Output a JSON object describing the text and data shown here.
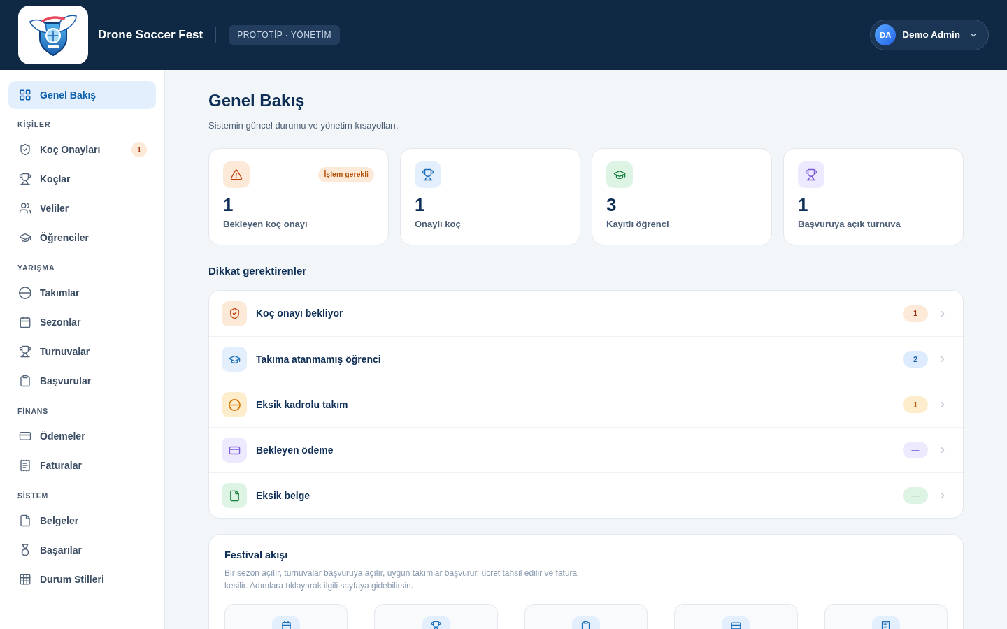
{
  "header": {
    "title": "Drone Soccer Fest",
    "badge": "PROTOTİP · YÖNETİM",
    "user": {
      "initials": "DA",
      "name": "Demo Admin"
    }
  },
  "sidebar": {
    "sections": [
      {
        "items": [
          {
            "label": "Genel Bakış",
            "selected": true
          }
        ]
      },
      {
        "heading": "KİŞİLER",
        "items": [
          {
            "label": "Koç Onayları",
            "selected": false,
            "badge": "1"
          },
          {
            "label": "Koçlar",
            "selected": false
          },
          {
            "label": "Veliler",
            "selected": false
          },
          {
            "label": "Öğrenciler",
            "selected": false
          }
        ]
      },
      {
        "heading": "YARIŞMA",
        "items": [
          {
            "label": "Takımlar",
            "selected": false
          },
          {
            "label": "Sezonlar",
            "selected": false
          },
          {
            "label": "Turnuvalar",
            "selected": false
          },
          {
            "label": "Başvurular",
            "selected": false
          }
        ]
      },
      {
        "heading": "FİNANS",
        "items": [
          {
            "label": "Ödemeler",
            "selected": false
          },
          {
            "label": "Faturalar",
            "selected": false
          }
        ]
      },
      {
        "heading": "SİSTEM",
        "items": [
          {
            "label": "Belgeler",
            "selected": false
          },
          {
            "label": "Başarılar",
            "selected": false
          },
          {
            "label": "Durum Stilleri",
            "selected": false
          }
        ]
      }
    ]
  },
  "page": {
    "title": "Genel Bakış",
    "subtitle": "Sistemin güncel durumu ve yönetim kısayolları."
  },
  "stats": [
    {
      "value": "1",
      "label": "Bekleyen koç onayı",
      "badge": "İşlem gerekli"
    },
    {
      "value": "1",
      "label": "Onaylı koç"
    },
    {
      "value": "3",
      "label": "Kayıtlı öğrenci"
    },
    {
      "value": "1",
      "label": "Başvuruya açık turnuva"
    }
  ],
  "attention": {
    "title": "Dikkat gerektirenler",
    "items": [
      {
        "label": "Koç onayı bekliyor",
        "count": "1"
      },
      {
        "label": "Takıma atanmamış öğrenci",
        "count": "2"
      },
      {
        "label": "Eksik kadrolu takım",
        "count": "1"
      },
      {
        "label": "Bekleyen ödeme",
        "count": "—"
      },
      {
        "label": "Eksik belge",
        "count": "—"
      }
    ]
  },
  "festival_flow": {
    "title": "Festival akışı",
    "description": "Bir sezon açılır, turnuvalar başvuruya açılır, uygun takımlar başvurur, ücret tahsil edilir ve fatura kesilir. Adımlara tıklayarak ilgili sayfaya gidebilirsin."
  }
}
